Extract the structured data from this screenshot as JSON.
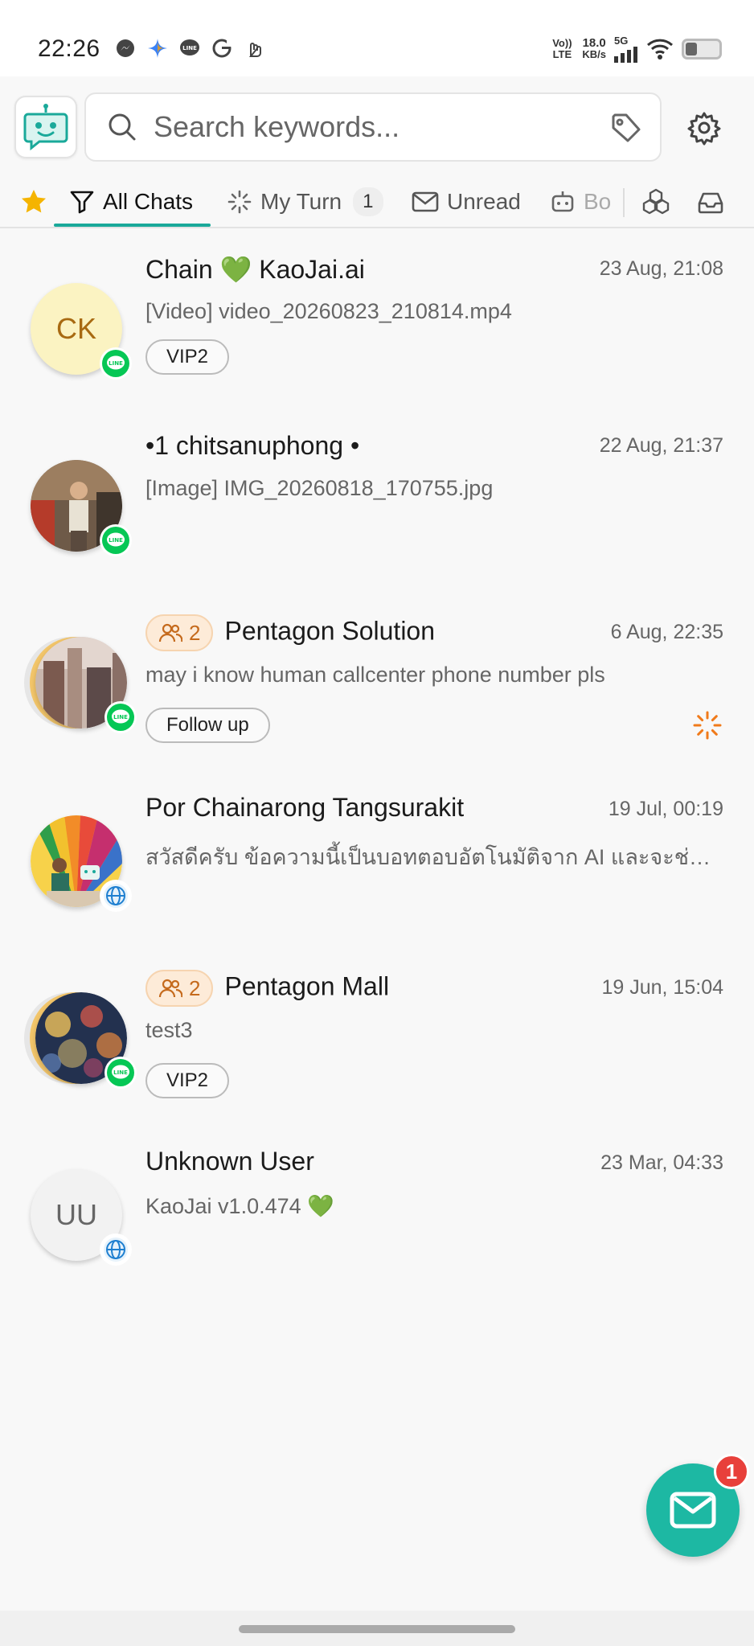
{
  "status_bar": {
    "time": "22:26",
    "network_label": "Vo)) LTE",
    "speed_value": "18.0",
    "speed_unit": "KB/s",
    "signal_label": "5G",
    "app_icons": [
      "messenger-icon",
      "gemini-icon",
      "line-icon",
      "google-icon",
      "finger-icon"
    ]
  },
  "header": {
    "search_placeholder": "Search keywords...",
    "logo_icon": "robot-chat-icon",
    "tag_icon": "tag-icon",
    "settings_icon": "gear-icon"
  },
  "tabs": {
    "favorites_icon": "star-icon",
    "all_chats": "All Chats",
    "my_turn": "My Turn",
    "my_turn_count": "1",
    "unread": "Unread",
    "bot": "Bo",
    "accent": "#1aa99a"
  },
  "chats": [
    {
      "name": "Chain 💚 KaoJai.ai",
      "date": "23 Aug, 21:08",
      "preview": "[Video] video_20260823_210814.mp4",
      "initials": "CK",
      "channel": "LINE",
      "label": "VIP2"
    },
    {
      "name": "•1 chitsanuphong •",
      "date": "22 Aug, 21:37",
      "preview": "[Image] IMG_20260818_170755.jpg",
      "channel": "LINE"
    },
    {
      "name": "Pentagon Solution",
      "date": "6 Aug, 22:35",
      "preview": "may i know human callcenter phone number pls",
      "group_count": "2",
      "channel": "LINE",
      "label": "Follow up"
    },
    {
      "name": "Por Chainarong Tangsurakit",
      "date": "19 Jul, 00:19",
      "preview": "สวัสดีครับ ข้อความนี้เป็นบอทตอบอัตโนมัติจาก AI และจะช่วยตอบคำถามของคุณ",
      "channel": "web"
    },
    {
      "name": "Pentagon Mall",
      "date": "19 Jun, 15:04",
      "preview": "test3",
      "group_count": "2",
      "channel": "LINE",
      "label": "VIP2"
    },
    {
      "name": "Unknown User",
      "date": "23 Mar, 04:33",
      "preview": "KaoJai v1.0.474 💚",
      "initials": "UU",
      "channel": "web"
    }
  ],
  "fab": {
    "icon": "mail-icon",
    "badge": "1"
  }
}
